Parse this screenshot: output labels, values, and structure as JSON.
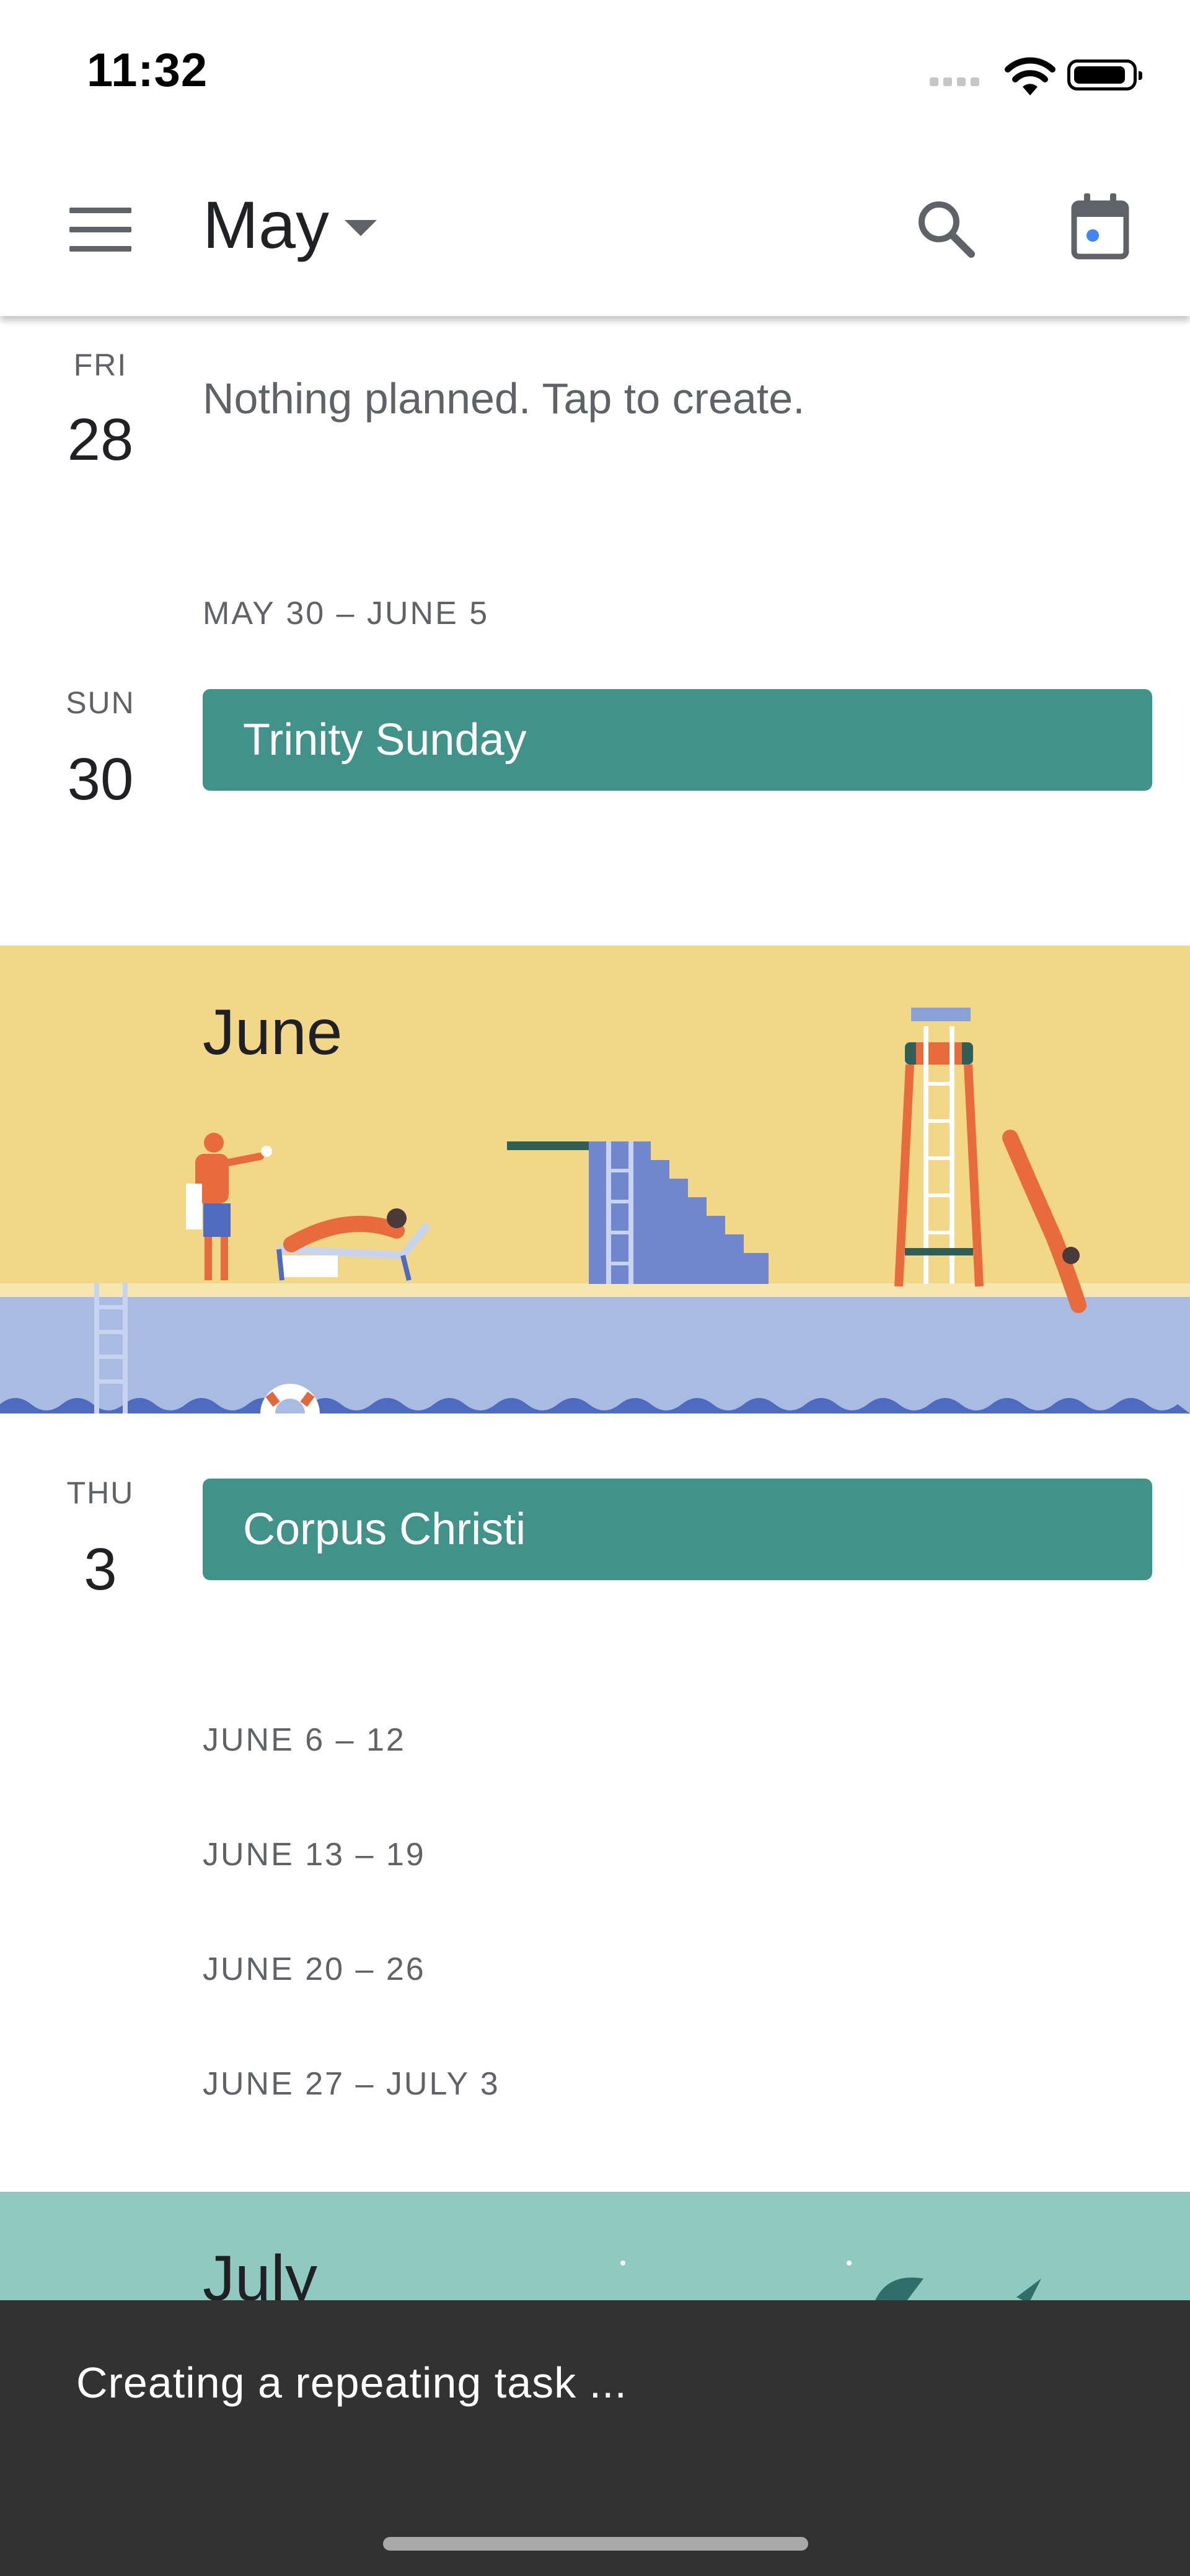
{
  "status_bar": {
    "time": "11:32"
  },
  "header": {
    "month": "May"
  },
  "schedule": {
    "day1": {
      "weekday": "FRI",
      "day": "28",
      "empty_text": "Nothing planned. Tap to create."
    },
    "week1": {
      "range": "MAY 30 – JUNE 5"
    },
    "day2": {
      "weekday": "SUN",
      "day": "30",
      "event": "Trinity Sunday"
    },
    "june_banner": {
      "title": "June"
    },
    "day3": {
      "weekday": "THU",
      "day": "3",
      "event": "Corpus Christi"
    },
    "weeks": [
      "JUNE 6 – 12",
      "JUNE 13 – 19",
      "JUNE 20 – 26",
      "JUNE 27 – JULY 3"
    ],
    "july_banner": {
      "title": "July"
    }
  },
  "snackbar": {
    "message": "Creating a repeating task ..."
  },
  "colors": {
    "event": "#41938a",
    "june_sky": "#f3d788",
    "june_water": "#a9bbe0",
    "july_banner": "#8fc9bf",
    "snackbar": "#323232"
  },
  "icons": [
    "menu-icon",
    "chevron-down-icon",
    "search-icon",
    "calendar-today-icon",
    "wifi-icon",
    "battery-icon",
    "signal-icon"
  ]
}
